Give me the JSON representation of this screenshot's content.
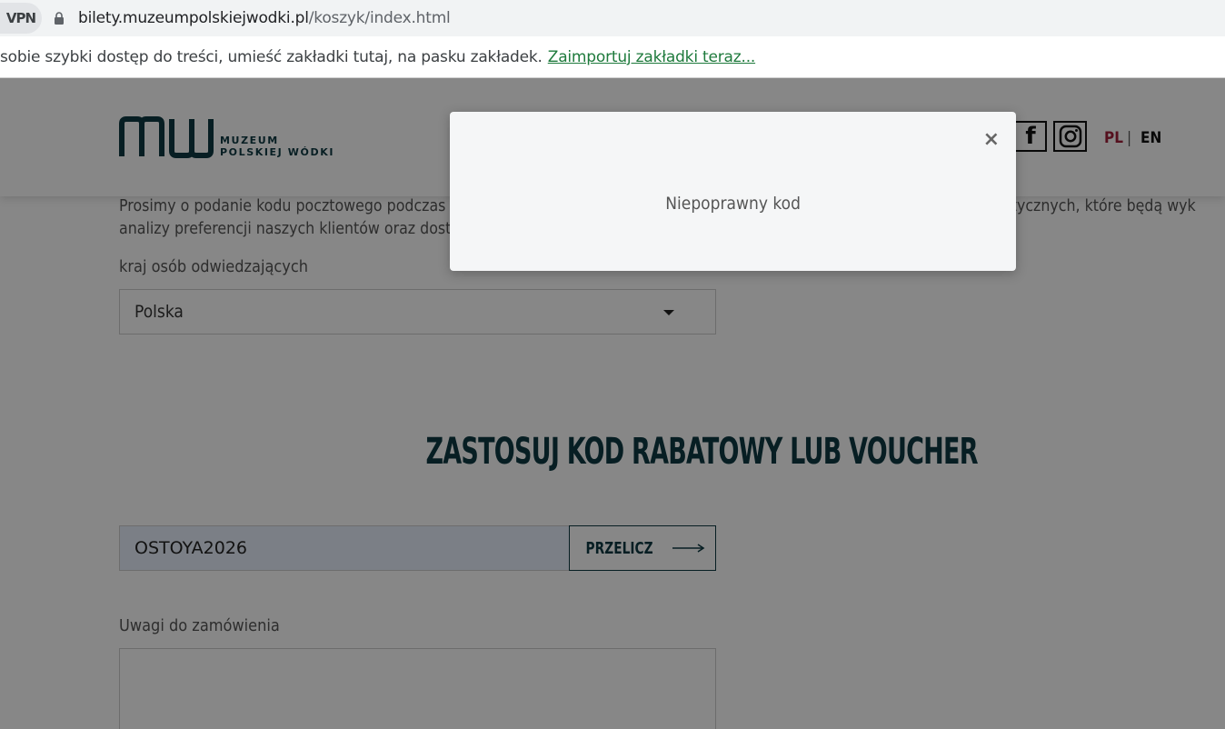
{
  "browser": {
    "vpn_label": "VPN",
    "url_host": "bilety.muzeumpolskiejwodki.pl",
    "url_path": "/koszyk/index.html",
    "bookmarks_hint": "sobie szybki dostęp do treści, umieść zakładki tutaj, na pasku zakładek.",
    "bookmarks_import_link": "Zaimportuj zakładki teraz..."
  },
  "header": {
    "logo_line1": "MUZEUM",
    "logo_line2": "POLSKIEJ WÓDKI",
    "lang_pl": "PL",
    "lang_separator": "|",
    "lang_en": "EN"
  },
  "form": {
    "info_line1": "Prosimy o podanie kodu pocztowego podczas składania zamówienia. Dane te będą wykorzystane wyłącznie do celów statystycznych, które będą wyk",
    "info_line2": "analizy preferencji naszych klientów oraz dost",
    "country_label": "kraj osób odwiedzających",
    "country_value": "Polska",
    "discount_title": "ZASTOSUJ KOD RABATOWY LUB VOUCHER",
    "discount_code_value": "OSTOYA2026",
    "recalc_label": "PRZELICZ",
    "notes_label": "Uwagi do zamówienia"
  },
  "modal": {
    "close_symbol": "×",
    "message": "Niepoprawny kod"
  },
  "colors": {
    "brand": "#0e3a42",
    "lang_active": "#a11f3a",
    "input_autofill": "#e9f0fd"
  }
}
